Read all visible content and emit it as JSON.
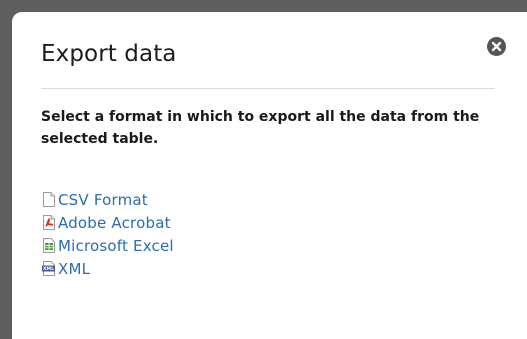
{
  "dialog": {
    "title": "Export data",
    "instructions": "Select a format in which to export all the data from the selected table.",
    "close_icon": "close-icon",
    "formats": [
      {
        "label": "CSV Format",
        "icon": "document-icon"
      },
      {
        "label": "Adobe Acrobat",
        "icon": "pdf-icon"
      },
      {
        "label": "Microsoft Excel",
        "icon": "spreadsheet-icon"
      },
      {
        "label": "XML",
        "icon": "xml-icon"
      }
    ]
  },
  "colors": {
    "link": "#2b6db0",
    "overlay": "#5f5f5f",
    "close_button": "#555555",
    "pdf_red": "#d9342b",
    "excel_green": "#4a9a3c"
  }
}
